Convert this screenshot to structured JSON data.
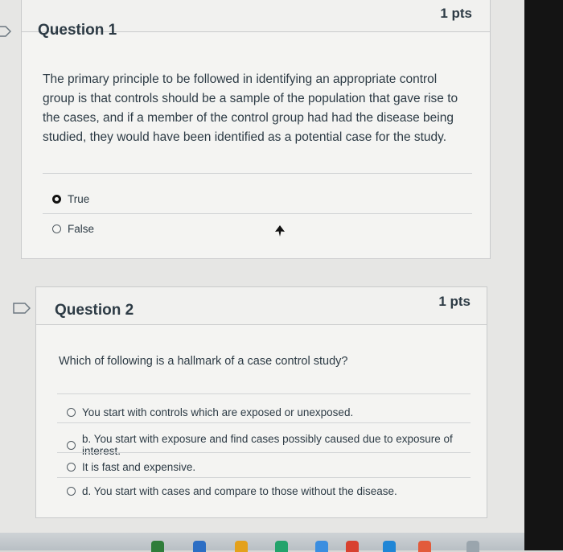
{
  "question1": {
    "title": "Question 1",
    "points": "1 pts",
    "text": "The primary principle to be followed in identifying an appropriate control group is that controls should be a sample of the population that gave rise to the cases, and if a member of the control group had had the disease being studied, they would have been identified as a potential case for the study.",
    "answers": [
      {
        "label": "True",
        "selected": true
      },
      {
        "label": "False",
        "selected": false
      }
    ]
  },
  "question2": {
    "title": "Question 2",
    "points": "1 pts",
    "text": "Which of following is a hallmark of a case control study?",
    "answers": [
      {
        "label": "You start with controls which are exposed or unexposed.",
        "selected": false
      },
      {
        "label": "b. You start with exposure and find cases possibly caused due to exposure of interest.",
        "selected": false
      },
      {
        "label": "It is fast and expensive.",
        "selected": false
      },
      {
        "label": "d. You start with cases and compare to those without the disease.",
        "selected": false
      }
    ]
  },
  "colors": {
    "page_background": "#e6e6e4",
    "card_background": "#f4f4f2",
    "text": "#2d3b45",
    "border": "#c9cacb"
  },
  "icons": {
    "question_marker": "question-flag-icon",
    "cursor": "mouse-pointer-icon"
  }
}
